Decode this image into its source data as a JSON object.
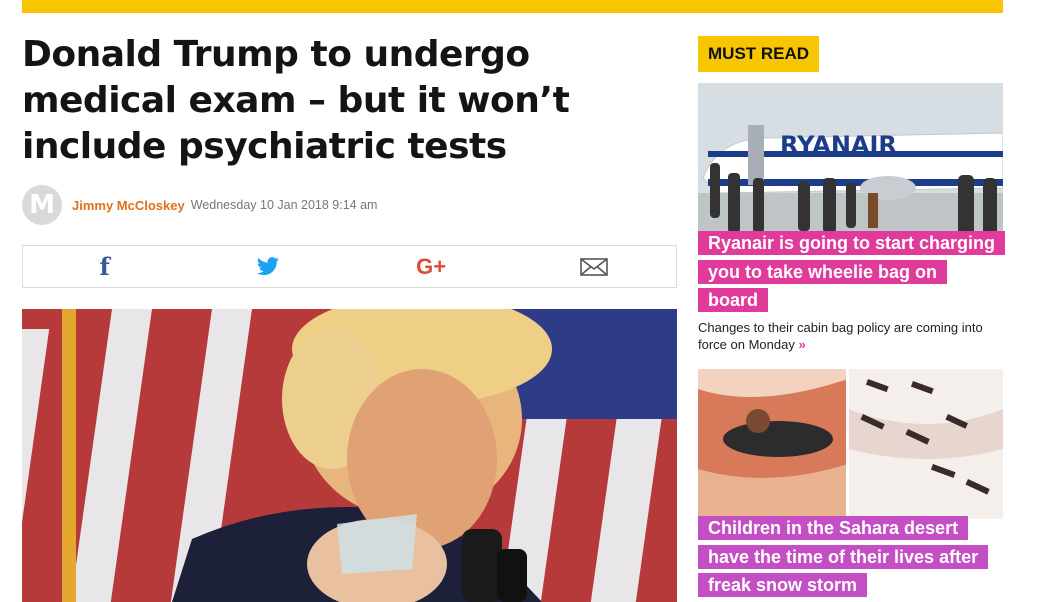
{
  "colors": {
    "accent_yellow": "#f7c600",
    "author_orange": "#e0701a",
    "pink": "#e03a9a",
    "purple": "#c44ec4"
  },
  "article": {
    "headline": "Donald Trump to undergo medical exam – but it won’t include psychiatric tests",
    "avatar_letter": "M",
    "author": "Jimmy McCloskey",
    "date": "Wednesday 10 Jan 2018 9:14 am"
  },
  "share": {
    "facebook_glyph": "f",
    "googleplus_glyph": "G+",
    "icons": [
      "facebook-icon",
      "twitter-icon",
      "google-plus-icon",
      "email-icon"
    ]
  },
  "sidebar": {
    "section_label": "MUST READ",
    "cards": [
      {
        "title": "Ryanair is going to start charging you to take wheelie bag on board",
        "subtitle": "Changes to their cabin bag policy are coming into force on Monday",
        "more_glyph": "»",
        "image_text": "RYANAIR"
      },
      {
        "title": "Children in the Sahara desert have the time of their lives after freak snow storm"
      }
    ]
  }
}
